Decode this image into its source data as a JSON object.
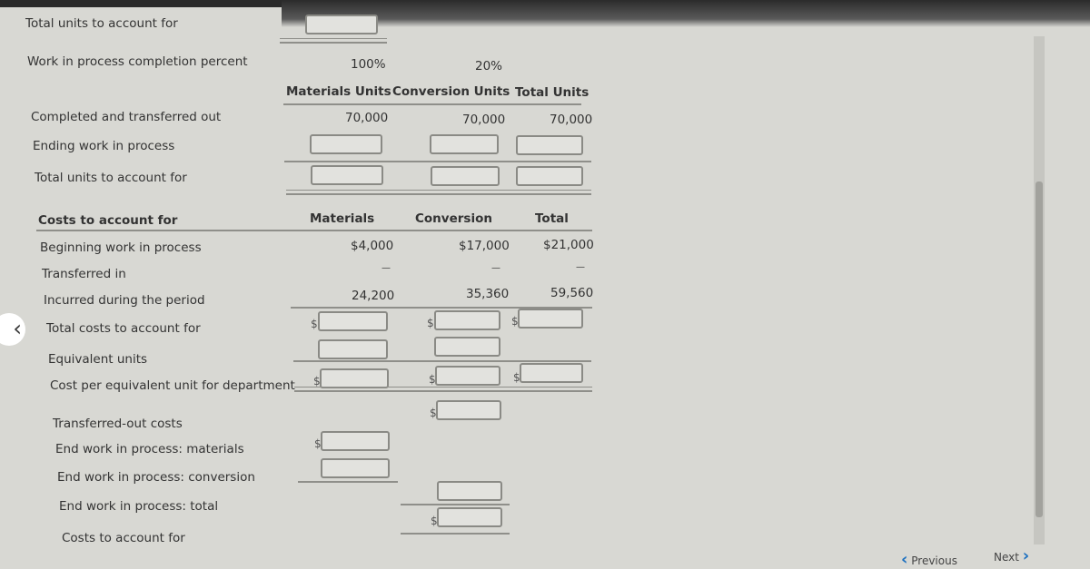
{
  "units": {
    "total_units_top_label": "Total units to account for",
    "completion_label": "Work in process completion percent",
    "completion_materials": "100%",
    "completion_conversion": "20%",
    "headers": [
      "Materials Units",
      "Conversion Units",
      "Total Units"
    ],
    "rows": [
      {
        "label": "Completed and transferred out",
        "values": [
          "70,000",
          "70,000",
          "70,000"
        ]
      },
      {
        "label": "Ending work in process"
      },
      {
        "label": "Total units to account for"
      }
    ]
  },
  "costs": {
    "section_label": "Costs to account for",
    "headers": [
      "Materials",
      "Conversion",
      "Total"
    ],
    "rows": [
      {
        "label": "Beginning work in process",
        "values": [
          "$4,000",
          "$17,000",
          "$21,000"
        ]
      },
      {
        "label": "Transferred in",
        "values": [
          "—",
          "—",
          "—"
        ]
      },
      {
        "label": "Incurred during the period",
        "values": [
          "24,200",
          "35,360",
          "59,560"
        ]
      },
      {
        "label": "Total costs to account for"
      },
      {
        "label": "Equivalent units"
      },
      {
        "label": "Cost per equivalent unit for department"
      }
    ]
  },
  "assigned": {
    "rows": [
      {
        "label": "Transferred-out costs"
      },
      {
        "label": "End work in process: materials"
      },
      {
        "label": "End work in process: conversion"
      },
      {
        "label": "End work in process: total"
      },
      {
        "label": "Costs to account for"
      }
    ]
  },
  "currency_symbol": "$",
  "nav": {
    "previous": "Previous",
    "next": "Next"
  }
}
